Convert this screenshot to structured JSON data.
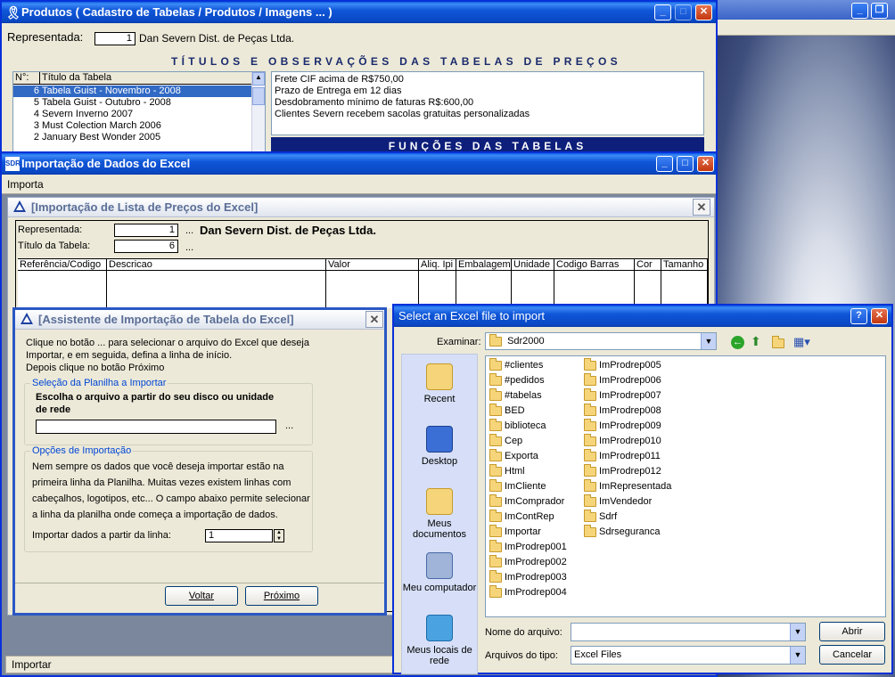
{
  "produtos": {
    "title": "Produtos ( Cadastro de Tabelas / Produtos / Imagens ... )",
    "representada_label": "Representada:",
    "representada_code": "1",
    "representada_name": "Dan Severn Dist. de Peças Ltda.",
    "banner": "TÍTULOS E OBSERVAÇÕES DAS TABELAS DE PREÇOS",
    "table_headers": [
      "N°:",
      "Título da Tabela"
    ],
    "rows": [
      {
        "n": "6",
        "title": "Tabela Guist - Novembro - 2008",
        "selected": true
      },
      {
        "n": "5",
        "title": "Tabela Guist - Outubro - 2008"
      },
      {
        "n": "4",
        "title": "Severn Inverno 2007"
      },
      {
        "n": "3",
        "title": "Must Colection March 2006"
      },
      {
        "n": "2",
        "title": "January Best Wonder 2005"
      }
    ],
    "obs": [
      "Frete CIF acima de R$750,00",
      "Prazo de Entrega em 12 dias",
      "Desdobramento mínimo de faturas R$:600,00",
      "Clientes Severn recebem sacolas gratuitas personalizadas"
    ],
    "funcoes": "FUNÇÕES DAS TABELAS"
  },
  "importacao": {
    "title": "Importação de Dados do Excel",
    "menu": "Importa",
    "status": "Importar"
  },
  "lista": {
    "title": "[Importação de Lista de Preços do Excel]",
    "representada_label": "Representada:",
    "representada_code": "1",
    "representada_dots": "...",
    "representada_name": "Dan Severn Dist. de Peças Ltda.",
    "titulo_label": "Título da Tabela:",
    "titulo_code": "6",
    "titulo_dots": "...",
    "columns": [
      "Referência/Codigo",
      "Descricao",
      "Valor",
      "Aliq. Ipi",
      "Embalagem",
      "Unidade",
      "Codigo Barras",
      "Cor",
      "Tamanho"
    ]
  },
  "assistente": {
    "title": "[Assistente de Importação de Tabela do Excel]",
    "intro": [
      "Clique no botão ... para selecionar o arquivo do Excel que deseja",
      "Importar, e em seguida, defina a linha de início.",
      "Depois clique no botão Próximo"
    ],
    "group1_label": "Seleção da Planilha a Importar",
    "group1_text": [
      "Escolha o arquivo a partir do seu disco ou unidade",
      "de rede"
    ],
    "browse": "...",
    "group2_label": "Opções de Importação",
    "group2_text": [
      "Nem sempre os dados que você deseja importar estão na",
      "primeira linha da Planilha. Muitas vezes existem linhas com",
      "cabeçalhos, logotipos, etc... O campo abaixo permite selecionar",
      "a linha da planilha onde  começa a importação de dados."
    ],
    "linha_label": "Importar dados a partir da linha:",
    "linha_value": "1",
    "voltar": "Voltar",
    "proximo": "Próximo"
  },
  "dialog": {
    "title": "Select an Excel file to import",
    "help": "?",
    "examinar_label": "Examinar:",
    "examinar_value": "Sdr2000",
    "places": [
      "Recent",
      "Desktop",
      "Meus documentos",
      "Meu computador",
      "Meus locais de rede"
    ],
    "folders_col1": [
      "#clientes",
      "#pedidos",
      "#tabelas",
      "BED",
      "biblioteca",
      "Cep",
      "Exporta",
      "Html",
      "ImCliente",
      "ImComprador",
      "ImContRep",
      "Importar",
      "ImProdrep001",
      "ImProdrep002",
      "ImProdrep003",
      "ImProdrep004"
    ],
    "folders_col2": [
      "ImProdrep005",
      "ImProdrep006",
      "ImProdrep007",
      "ImProdrep008",
      "ImProdrep009",
      "ImProdrep010",
      "ImProdrep011",
      "ImProdrep012",
      "ImRepresentada",
      "ImVendedor",
      "Sdrf",
      "Sdrseguranca"
    ],
    "nome_label": "Nome do arquivo:",
    "nome_value": "",
    "tipo_label": "Arquivos do tipo:",
    "tipo_value": "Excel Files",
    "abrir": "Abrir",
    "cancelar": "Cancelar"
  }
}
